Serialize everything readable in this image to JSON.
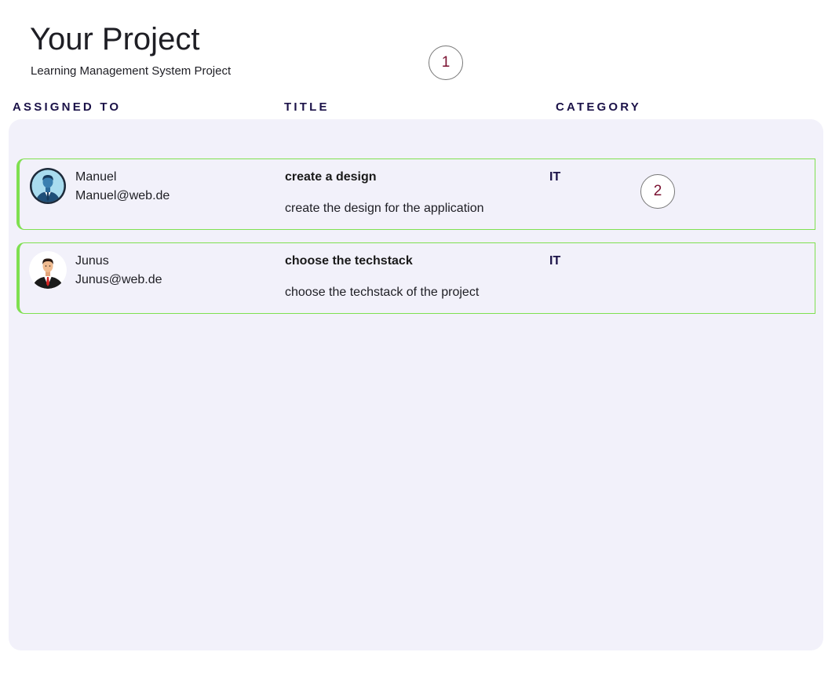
{
  "header": {
    "title": "Your Project",
    "subtitle": "Learning Management System Project"
  },
  "markers": [
    "1",
    "2"
  ],
  "columns": {
    "assigned_to": "ASSIGNED TO",
    "title": "TITLE",
    "category": "CATEGORY"
  },
  "tasks": [
    {
      "user_name": "Manuel",
      "user_email": "Manuel@web.de",
      "avatar_icon": "businessman-blue-avatar-icon",
      "title": "create a design",
      "description": "create the design for the application",
      "category": "IT"
    },
    {
      "user_name": "Junus",
      "user_email": "Junus@web.de",
      "avatar_icon": "businessman-red-tie-avatar-icon",
      "title": "choose the techstack",
      "description": "choose the techstack of the project",
      "category": "IT"
    }
  ],
  "colors": {
    "accent_border": "#7fe050",
    "panel_background": "#f2f1fa",
    "header_text": "#1b1248",
    "marker_text": "#7a1030"
  }
}
